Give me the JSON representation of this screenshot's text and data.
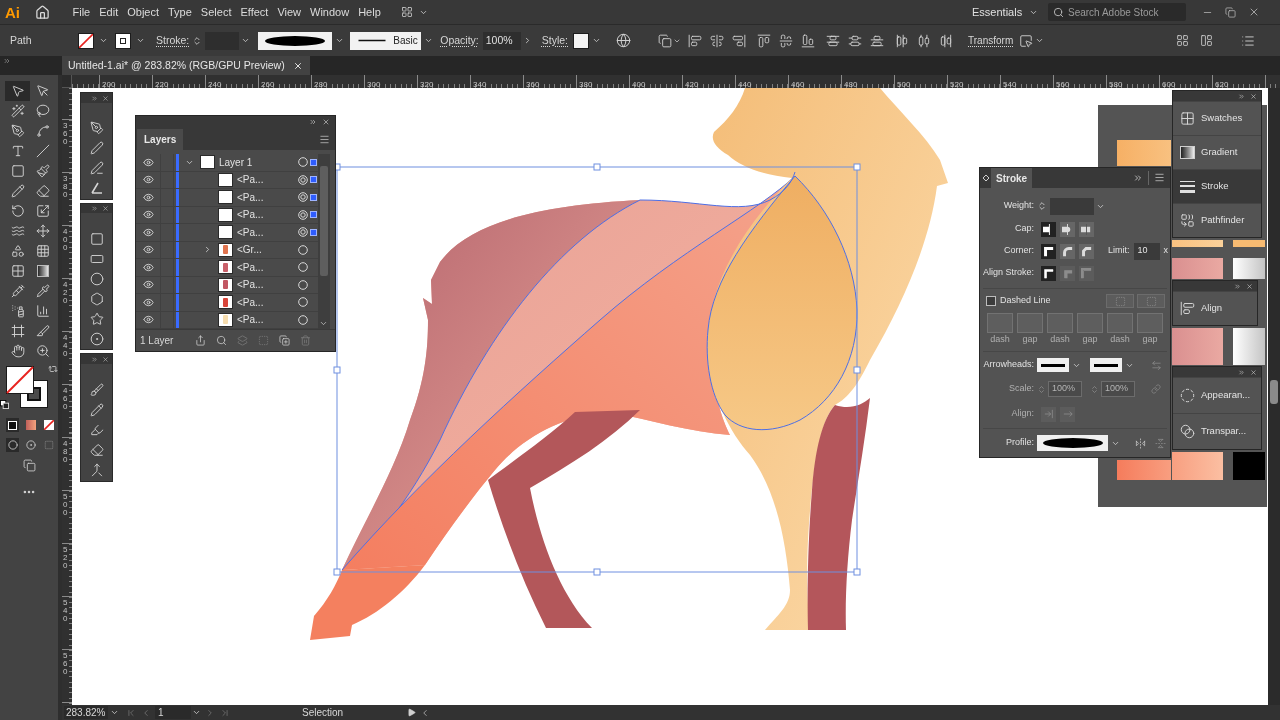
{
  "menu_bar": {
    "logo": "Ai",
    "menus": [
      {
        "label": "File"
      },
      {
        "label": "Edit"
      },
      {
        "label": "Object"
      },
      {
        "label": "Type"
      },
      {
        "label": "Select"
      },
      {
        "label": "Effect"
      },
      {
        "label": "View"
      },
      {
        "label": "Window"
      },
      {
        "label": "Help"
      }
    ],
    "workspace": "Essentials",
    "search": {
      "placeholder": "Search Adobe Stock"
    }
  },
  "control_bar": {
    "selection": "Path",
    "stroke_label": "Stroke:",
    "brush": "Basic",
    "opacity_label": "Opacity:",
    "opacity": "100%",
    "style_label": "Style:",
    "transform": "Transform"
  },
  "document_tab": {
    "title": "Untitled-1.ai* @ 283.82% (RGB/GPU Preview)"
  },
  "rulers": {
    "horizontal": [
      "200",
      "220",
      "240",
      "260",
      "280",
      "300",
      "320",
      "340",
      "360",
      "380",
      "400",
      "420",
      "440",
      "460",
      "480",
      "500",
      "520",
      "540",
      "560",
      "580",
      "600",
      "620"
    ],
    "vertical": [
      "360",
      "380",
      "400",
      "420",
      "440",
      "460",
      "480",
      "500",
      "520",
      "540",
      "560"
    ]
  },
  "toolbar": {
    "tools": [
      {
        "selected": true
      },
      {
        "selected": false
      },
      {
        "selected": false
      },
      {
        "selected": false
      },
      {
        "selected": false
      },
      {
        "selected": false
      },
      {
        "selected": false
      },
      {
        "selected": false
      },
      {
        "selected": false
      },
      {
        "selected": false
      },
      {
        "selected": false
      },
      {
        "selected": false
      },
      {
        "selected": false
      },
      {
        "selected": false
      },
      {
        "selected": false
      },
      {
        "selected": false
      },
      {
        "selected": false
      },
      {
        "selected": false
      },
      {
        "selected": false
      },
      {
        "selected": false
      },
      {
        "selected": false
      },
      {
        "selected": false
      },
      {
        "selected": false
      },
      {
        "selected": false
      },
      {
        "selected": false
      },
      {
        "selected": false
      },
      {
        "selected": false
      },
      {
        "selected": false
      }
    ]
  },
  "layers_panel": {
    "title": "Layers",
    "layers": [
      {
        "name": "Layer 1",
        "visible": true,
        "expanded": true,
        "targeted": false,
        "selected": true,
        "children": [
          {
            "name": "<Pa...",
            "kind": "path",
            "visible": true,
            "targeted": true,
            "selected": true
          },
          {
            "name": "<Pa...",
            "kind": "path",
            "visible": true,
            "targeted": true,
            "selected": true
          },
          {
            "name": "<Pa...",
            "kind": "path",
            "visible": true,
            "targeted": true,
            "selected": true
          },
          {
            "name": "<Pa...",
            "kind": "path",
            "visible": true,
            "targeted": true,
            "selected": true
          },
          {
            "name": "<Gr...",
            "kind": "group",
            "expanded": false,
            "visible": true,
            "targeted": false,
            "selected": false,
            "color": "#e0744f"
          },
          {
            "name": "<Pa...",
            "kind": "path",
            "visible": true,
            "targeted": false,
            "selected": false,
            "color": "#c9606a"
          },
          {
            "name": "<Pa...",
            "kind": "path",
            "visible": true,
            "targeted": false,
            "selected": false,
            "color": "#c25763"
          },
          {
            "name": "<Pa...",
            "kind": "path",
            "visible": true,
            "targeted": false,
            "selected": false,
            "color": "#d9453a"
          },
          {
            "name": "<Pa...",
            "kind": "path",
            "visible": true,
            "targeted": false,
            "selected": false,
            "color": "#f6dcae"
          }
        ]
      }
    ],
    "footer": "1 Layer",
    "footer_buttons": [
      {
        "disabled": false
      },
      {
        "disabled": false
      },
      {
        "disabled": true
      },
      {
        "disabled": true
      },
      {
        "disabled": false
      },
      {
        "disabled": true
      }
    ]
  },
  "stroke_panel": {
    "title": "Stroke",
    "weight_label": "Weight:",
    "cap_label": "Cap:",
    "caps": [
      {
        "selected": true
      },
      {
        "selected": false
      },
      {
        "selected": false
      }
    ],
    "corner_label": "Corner:",
    "corners": [
      {
        "selected": true
      },
      {
        "selected": false
      },
      {
        "selected": false
      }
    ],
    "limit_label": "Limit:",
    "limit": "10",
    "limit_unit": "x",
    "align_stroke_label": "Align Stroke:",
    "align_stroke": [
      {
        "selected": true,
        "disabled": false
      },
      {
        "selected": false,
        "disabled": true
      },
      {
        "selected": false,
        "disabled": true
      }
    ],
    "dashed_line": {
      "label": "Dashed Line",
      "checked": false
    },
    "dash_pattern": {
      "disabled": true,
      "fields": [
        {
          "label": "dash"
        },
        {
          "label": "gap"
        },
        {
          "label": "dash"
        },
        {
          "label": "gap"
        },
        {
          "label": "dash"
        },
        {
          "label": "gap"
        }
      ]
    },
    "arrowheads_label": "Arrowheads:",
    "scale": {
      "label": "Scale:",
      "disabled": true,
      "values": [
        "100%",
        "100%"
      ]
    },
    "align": {
      "label": "Align:",
      "disabled": true
    },
    "profile_label": "Profile:"
  },
  "panel_dock": {
    "groups": [
      {
        "items": [
          {
            "label": "Swatches",
            "kind": "swatches",
            "selected": false
          },
          {
            "label": "Gradient",
            "kind": "gradient",
            "selected": false
          },
          {
            "label": "Stroke",
            "kind": "stroke",
            "selected": true
          },
          {
            "label": "Pathfinder",
            "kind": "pathfinder",
            "selected": false
          }
        ]
      },
      {
        "items": [
          {
            "label": "Align",
            "kind": "align",
            "selected": false
          }
        ]
      },
      {
        "items": [
          {
            "label": "Appearan...",
            "kind": "appearance",
            "selected": false
          },
          {
            "label": "Transpar...",
            "kind": "transparency",
            "selected": false
          }
        ]
      }
    ]
  },
  "status_bar": {
    "zoom": "283.82%",
    "artboard": "1",
    "tool": "Selection"
  }
}
